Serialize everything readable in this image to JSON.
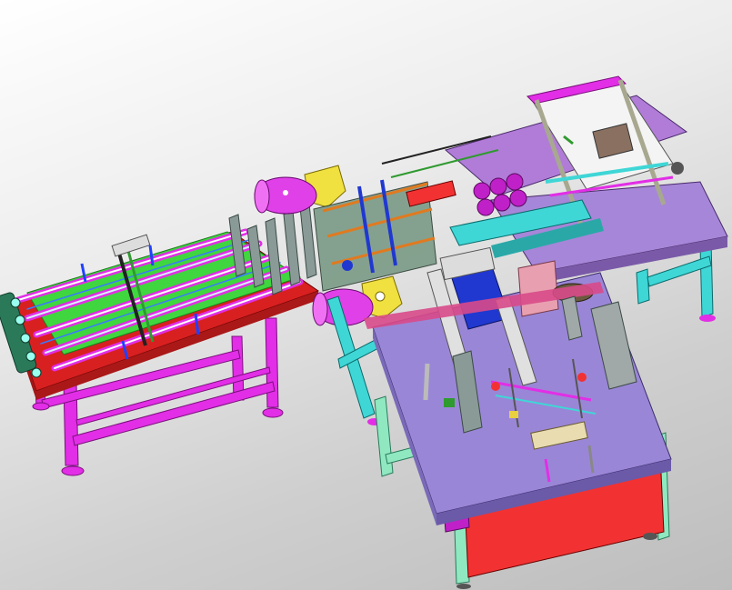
{
  "viewport": {
    "background_top": "#ffffff",
    "background_bottom": "#bdbdbd"
  },
  "colors": {
    "frame_magenta": "#e22ee6",
    "frame_cyan": "#3fd6d6",
    "frame_mint": "#8fe8c0",
    "table_purple": "#9a86d6",
    "table_violet": "#b07cd8",
    "panel_red": "#f23232",
    "rail_green": "#4be04b",
    "motor_magenta": "#e040e8",
    "motor_yellow": "#f0e040",
    "plate_gray": "#9aa0a0",
    "accent_blue": "#2038d0",
    "accent_orange": "#e07a20",
    "white_panel": "#f4f4f4"
  },
  "assembly": {
    "conveyor": "feed-conveyor",
    "rear_station": "rear-press-station",
    "front_station": "front-forming-station",
    "motors": [
      "motor-upper",
      "motor-lower"
    ]
  }
}
